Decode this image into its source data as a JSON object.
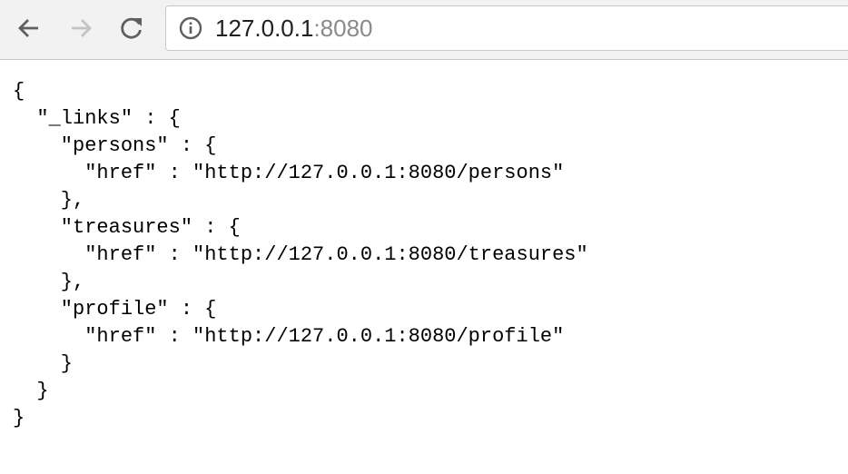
{
  "browser": {
    "url_host": "127.0.0.1",
    "url_port": ":8080",
    "icons": {
      "back": "arrow-left-icon",
      "forward": "arrow-right-icon",
      "reload": "reload-icon",
      "info": "info-circle-icon"
    }
  },
  "json_lines": [
    "{",
    "  \"_links\" : {",
    "    \"persons\" : {",
    "      \"href\" : \"http://127.0.0.1:8080/persons\"",
    "    },",
    "    \"treasures\" : {",
    "      \"href\" : \"http://127.0.0.1:8080/treasures\"",
    "    },",
    "    \"profile\" : {",
    "      \"href\" : \"http://127.0.0.1:8080/profile\"",
    "    }",
    "  }",
    "}"
  ]
}
